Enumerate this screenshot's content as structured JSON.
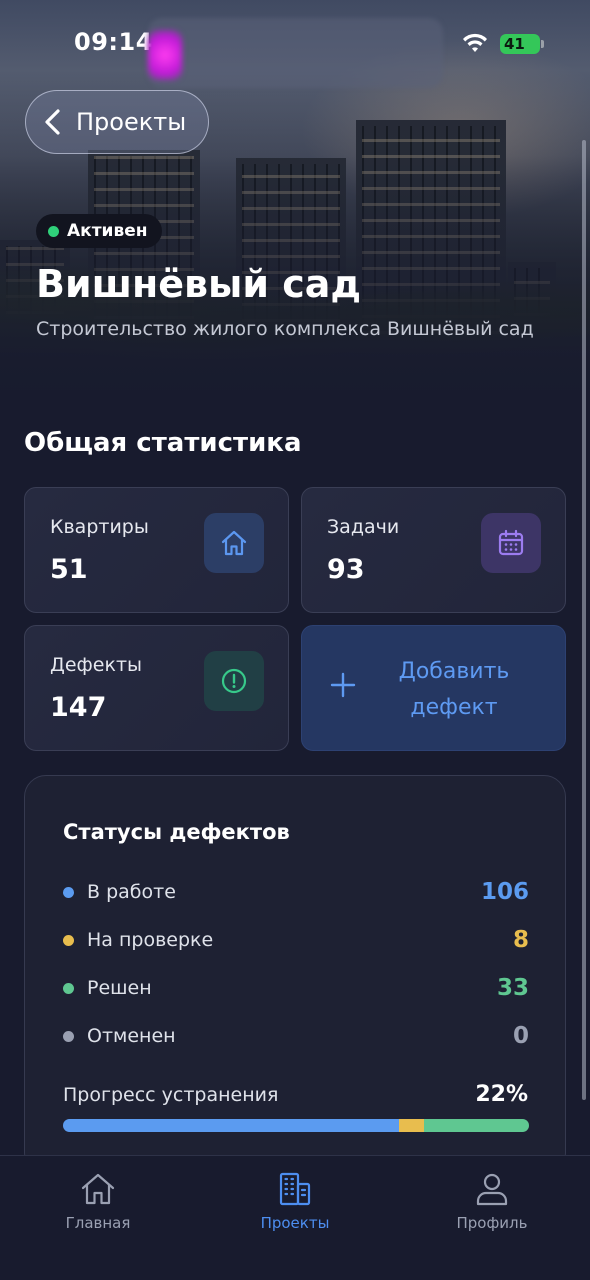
{
  "status_bar": {
    "time": "09:14",
    "battery": "41"
  },
  "header": {
    "back_label": "Проекты"
  },
  "project": {
    "status": "Активен",
    "title": "Вишнёвый сад",
    "subtitle": "Строительство жилого комплекса Вишнёвый сад"
  },
  "stats": {
    "section_title": "Общая статистика",
    "apartments": {
      "label": "Квартиры",
      "value": "51",
      "icon": "house-icon"
    },
    "tasks": {
      "label": "Задачи",
      "value": "93",
      "icon": "calendar-icon"
    },
    "defects": {
      "label": "Дефекты",
      "value": "147",
      "icon": "alert-circle-icon"
    },
    "add_defect": {
      "label": "Добавить дефект",
      "icon": "plus-icon"
    }
  },
  "defect_statuses": {
    "title": "Статусы дефектов",
    "items": [
      {
        "label": "В работе",
        "count": "106",
        "color": "#5b9bf0"
      },
      {
        "label": "На проверке",
        "count": "8",
        "color": "#e8bd4e"
      },
      {
        "label": "Решен",
        "count": "33",
        "color": "#5fc791"
      },
      {
        "label": "Отменен",
        "count": "0",
        "color": "#9aa0b2"
      }
    ],
    "progress_label": "Прогресс устранения",
    "progress_value": "22%",
    "progress_segments": [
      {
        "status": "В работе",
        "fraction": 0.72,
        "color": "#5b9bf0"
      },
      {
        "status": "На проверке",
        "fraction": 0.055,
        "color": "#e8bd4e"
      },
      {
        "status": "Решен",
        "fraction": 0.225,
        "color": "#5fc791"
      }
    ]
  },
  "tabbar": {
    "items": [
      {
        "label": "Главная",
        "icon": "home-icon",
        "active": false
      },
      {
        "label": "Проекты",
        "icon": "buildings-icon",
        "active": true
      },
      {
        "label": "Профиль",
        "icon": "user-icon",
        "active": false
      }
    ]
  },
  "colors": {
    "accent": "#4d8ef0",
    "background": "#181b2e",
    "active_badge": "#2fd07a"
  }
}
